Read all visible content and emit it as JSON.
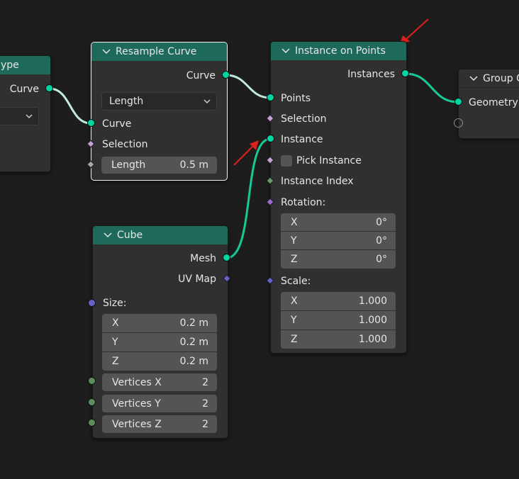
{
  "nodes": {
    "left_partial": {
      "title": "ype",
      "output_label": "Curve"
    },
    "resample_curve": {
      "title": "Resample Curve",
      "output_curve": "Curve",
      "mode_value": "Length",
      "input_curve": "Curve",
      "input_selection": "Selection",
      "length_label": "Length",
      "length_value": "0.5 m"
    },
    "instance_on_points": {
      "title": "Instance on Points",
      "output_instances": "Instances",
      "input_points": "Points",
      "input_selection": "Selection",
      "input_instance": "Instance",
      "pick_instance": "Pick Instance",
      "instance_index": "Instance Index",
      "rotation_label": "Rotation:",
      "rotation": [
        {
          "axis": "X",
          "value": "0°"
        },
        {
          "axis": "Y",
          "value": "0°"
        },
        {
          "axis": "Z",
          "value": "0°"
        }
      ],
      "scale_label": "Scale:",
      "scale": [
        {
          "axis": "X",
          "value": "1.000"
        },
        {
          "axis": "Y",
          "value": "1.000"
        },
        {
          "axis": "Z",
          "value": "1.000"
        }
      ]
    },
    "cube": {
      "title": "Cube",
      "output_mesh": "Mesh",
      "output_uvmap": "UV Map",
      "size_label": "Size:",
      "size": [
        {
          "axis": "X",
          "value": "0.2 m"
        },
        {
          "axis": "Y",
          "value": "0.2 m"
        },
        {
          "axis": "Z",
          "value": "0.2 m"
        }
      ],
      "vertices": [
        {
          "label": "Vertices X",
          "value": "2"
        },
        {
          "label": "Vertices Y",
          "value": "2"
        },
        {
          "label": "Vertices Z",
          "value": "2"
        }
      ]
    },
    "group_output": {
      "title": "Group O",
      "input_geometry": "Geometry"
    }
  },
  "colors": {
    "background": "#1d1d1d",
    "node_body": "#303030",
    "header_geometry": "#1e6a5a",
    "geometry_socket": "#00d6a3",
    "link_geometry": "#2fd6a3",
    "link_curve": "#bfeadc",
    "annotation_arrow": "#e01f1f"
  }
}
